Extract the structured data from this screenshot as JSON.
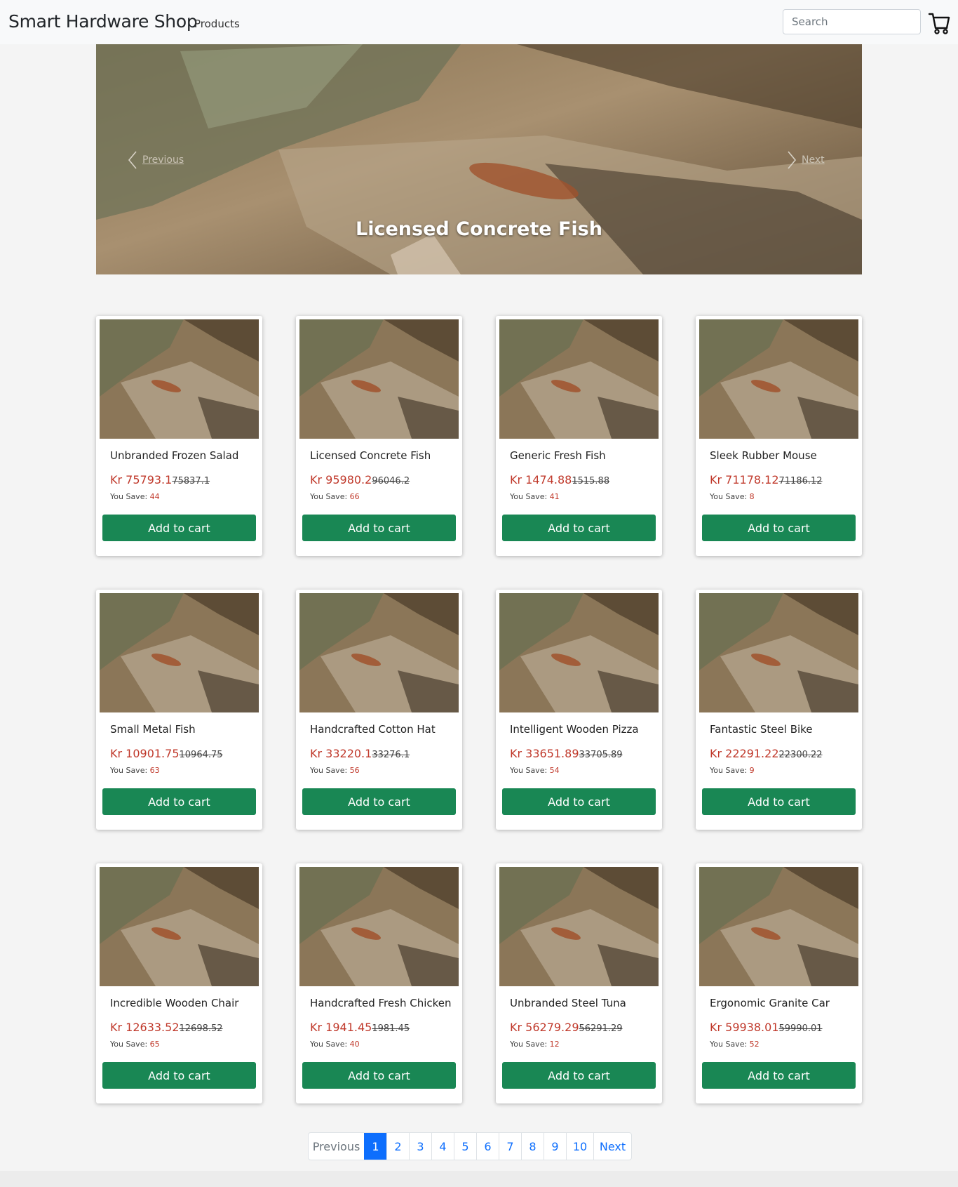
{
  "navbar": {
    "brand": "Smart Hardware Shop",
    "products_link": "Products",
    "search_placeholder": "Search",
    "cart_icon": "cart-icon"
  },
  "carousel": {
    "previous_label": "Previous",
    "next_label": "Next",
    "caption": "Licensed Concrete Fish"
  },
  "product_common": {
    "add_to_cart": "Add to cart",
    "you_save_label": "You Save:",
    "currency": "Kr"
  },
  "products": [
    {
      "name": "Unbranded Frozen Salad",
      "price": "Kr 75793.1",
      "original": "75837.1",
      "save": "44"
    },
    {
      "name": "Licensed Concrete Fish",
      "price": "Kr 95980.2",
      "original": "96046.2",
      "save": "66"
    },
    {
      "name": "Generic Fresh Fish",
      "price": "Kr 1474.88",
      "original": "1515.88",
      "save": "41"
    },
    {
      "name": "Sleek Rubber Mouse",
      "price": "Kr 71178.12",
      "original": "71186.12",
      "save": "8"
    },
    {
      "name": "Small Metal Fish",
      "price": "Kr 10901.75",
      "original": "10964.75",
      "save": "63"
    },
    {
      "name": "Handcrafted Cotton Hat",
      "price": "Kr 33220.1",
      "original": "33276.1",
      "save": "56"
    },
    {
      "name": "Intelligent Wooden Pizza",
      "price": "Kr 33651.89",
      "original": "33705.89",
      "save": "54"
    },
    {
      "name": "Fantastic Steel Bike",
      "price": "Kr 22291.22",
      "original": "22300.22",
      "save": "9"
    },
    {
      "name": "Incredible Wooden Chair",
      "price": "Kr 12633.52",
      "original": "12698.52",
      "save": "65"
    },
    {
      "name": "Handcrafted Fresh Chicken",
      "price": "Kr 1941.45",
      "original": "1981.45",
      "save": "40"
    },
    {
      "name": "Unbranded Steel Tuna",
      "price": "Kr 56279.29",
      "original": "56291.29",
      "save": "12"
    },
    {
      "name": "Ergonomic Granite Car",
      "price": "Kr 59938.01",
      "original": "59990.01",
      "save": "52"
    }
  ],
  "pagination": {
    "previous": "Previous",
    "pages": [
      "1",
      "2",
      "3",
      "4",
      "5",
      "6",
      "7",
      "8",
      "9",
      "10"
    ],
    "active": "1",
    "next": "Next"
  },
  "colors": {
    "button_green": "#198754",
    "price_red": "#c0392b",
    "link_blue": "#0d6efd"
  }
}
